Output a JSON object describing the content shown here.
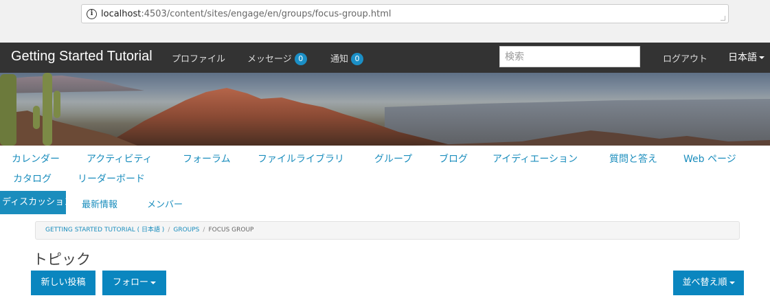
{
  "browser": {
    "url_host": "localhost",
    "url_rest": ":4503/content/sites/engage/en/groups/focus-group.html"
  },
  "topnav": {
    "brand": "Getting Started Tutorial",
    "profile": "プロファイル",
    "messages": "メッセージ",
    "messages_count": "0",
    "notifications": "通知",
    "notifications_count": "0",
    "search_placeholder": "検索",
    "logout": "ログアウト",
    "language": "日本語"
  },
  "community_nav": {
    "items": [
      "カレンダー",
      "アクティビティ",
      "フォーラム",
      "ファイルライブラリ",
      "グループ",
      "ブログ",
      "アイディエーション",
      "質問と答え",
      "Web ページ",
      "カタログ",
      "リーダーボード"
    ]
  },
  "group_tabs": {
    "items": [
      "ディスカッション",
      "最新情報",
      "メンバー"
    ],
    "active_index": 0
  },
  "breadcrumb": {
    "items": [
      "GETTING STARTED TUTORIAL ( 日本語 )",
      "GROUPS",
      "FOCUS GROUP"
    ],
    "separator": "/"
  },
  "main": {
    "heading": "トピック",
    "new_post": "新しい投稿",
    "follow": "フォロー",
    "sort": "並べ替え順"
  },
  "colors": {
    "accent": "#1a8dbd",
    "topnav_bg": "#333333",
    "badge": "#1b8fc6"
  }
}
